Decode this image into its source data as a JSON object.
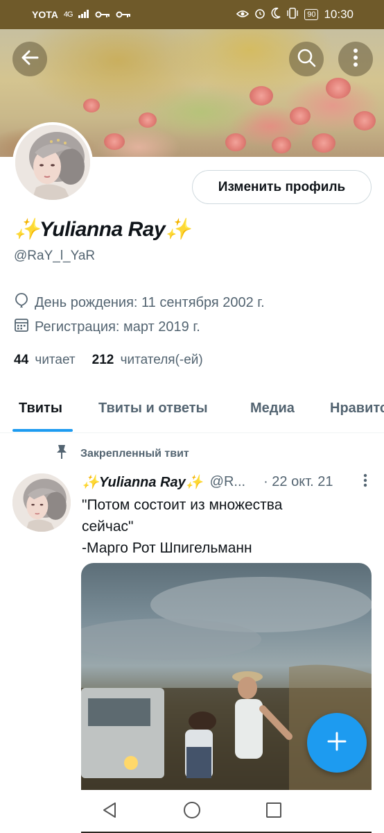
{
  "status_bar": {
    "carrier": "YOTA",
    "network": "4G",
    "battery": "90",
    "time": "10:30"
  },
  "banner": {
    "back_icon": "arrow-left-icon",
    "search_icon": "search-icon",
    "more_icon": "more-vertical-icon"
  },
  "profile": {
    "edit_button": "Изменить профиль",
    "display_name": "✨Yulianna Ray✨",
    "handle": "@RaY_l_YaR",
    "birthday": "День рождения: 11 сентября 2002 г.",
    "joined": "Регистрация: март 2019 г.",
    "following_count": "44",
    "following_label": "читает",
    "followers_count": "212",
    "followers_label": "читателя(-ей)"
  },
  "tabs": [
    {
      "label": "Твиты",
      "active": true
    },
    {
      "label": "Твиты и ответы",
      "active": false
    },
    {
      "label": "Медиа",
      "active": false
    },
    {
      "label": "Нравится",
      "active": false
    }
  ],
  "tweet": {
    "pinned_label": "Закрепленный твит",
    "author_name": "✨Yulianna Ray✨",
    "author_handle": "@R...",
    "date": "· 22 окт. 21",
    "text_lines": [
      "\"Потом состоит из множества",
      "сейчас\"",
      "-Марго Рот Шпигельманн"
    ]
  },
  "colors": {
    "accent": "#1d9bf0",
    "status_bar": "#6f5a2a",
    "secondary_text": "#536471"
  }
}
